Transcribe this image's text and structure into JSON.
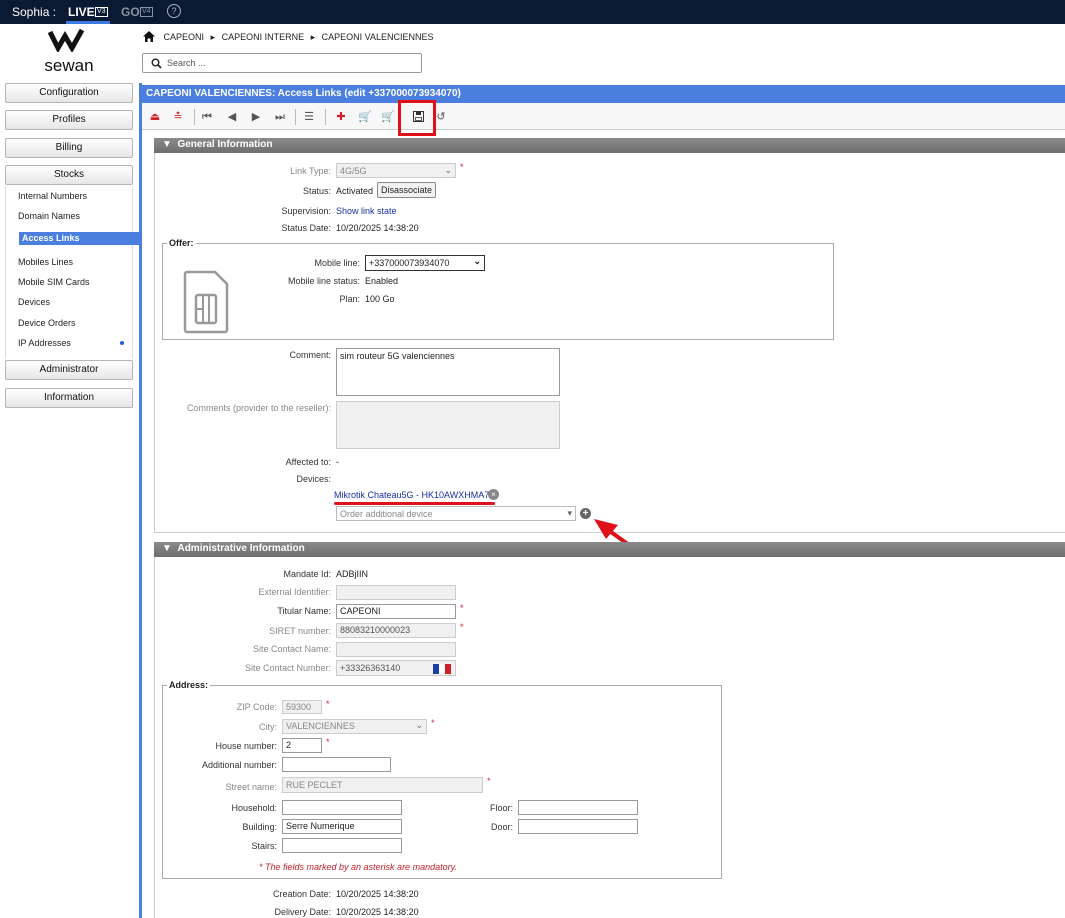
{
  "topbar": {
    "user": "Sophia :",
    "live_label": "LIVE",
    "live_badge": "V3",
    "go_label": "GO",
    "go_badge": "V4",
    "help": "?"
  },
  "logo": {
    "text": "sewan"
  },
  "breadcrumb": [
    "CAPEONI",
    "CAPEONI INTERNE",
    "CAPEONI VALENCIENNES"
  ],
  "search": {
    "placeholder": "Search ..."
  },
  "sidebar": {
    "buttons": {
      "configuration": "Configuration",
      "profiles": "Profiles",
      "billing": "Billing",
      "stocks": "Stocks",
      "administrator": "Administrator",
      "information": "Information"
    },
    "stocks_items": {
      "internal_numbers": "Internal Numbers",
      "domain_names": "Domain Names",
      "access_links": "Access Links",
      "mobiles_lines": "Mobiles Lines",
      "mobile_sim_cards": "Mobile SIM Cards",
      "devices": "Devices",
      "device_orders": "Device Orders",
      "ip_addresses": "IP Addresses"
    }
  },
  "page": {
    "title": "CAPEONI VALENCIENNES: Access Links (edit +337000073934070)"
  },
  "general": {
    "header": "General Information",
    "link_type_label": "Link Type:",
    "link_type_value": "4G/5G",
    "status_label": "Status:",
    "status_value": "Activated",
    "disassociate": "Disassociate",
    "supervision_label": "Supervision:",
    "supervision_link": "Show link state",
    "status_date_label": "Status Date:",
    "status_date_value": "10/20/2025 14:38:20",
    "offer_legend": "Offer:",
    "mobile_line_label": "Mobile line:",
    "mobile_line_value": "+337000073934070",
    "mobile_line_status_label": "Mobile line status:",
    "mobile_line_status_value": "Enabled",
    "plan_label": "Plan:",
    "plan_value": "100 Go",
    "comment_label": "Comment:",
    "comment_value": "sim routeur 5G valenciennes",
    "comments_provider_label": "Comments (provider to the reseller):",
    "affected_label": "Affected to:",
    "affected_value": "-",
    "devices_label": "Devices:",
    "device_value": "Mikrotik Chateau5G - HK10AWXHMA7",
    "order_device_placeholder": "Order additional device"
  },
  "admin": {
    "header": "Administrative Information",
    "mandate_label": "Mandate Id:",
    "mandate_value": "ADBjIIN",
    "external_label": "External Identifier:",
    "titular_label": "Titular Name:",
    "titular_value": "CAPEONI",
    "siret_label": "SIRET number:",
    "siret_value": "88083210000023",
    "site_contact_name_label": "Site Contact Name:",
    "site_contact_number_label": "Site Contact Number:",
    "site_contact_number_value": "+33326363140",
    "address_legend": "Address:",
    "zip_label": "ZIP Code:",
    "zip_value": "59300",
    "city_label": "City:",
    "city_value": "VALENCIENNES",
    "house_label": "House number:",
    "house_value": "2",
    "additional_label": "Additional number:",
    "street_label": "Street name:",
    "street_value": "RUE PECLET",
    "household_label": "Household:",
    "floor_label": "Floor:",
    "building_label": "Building:",
    "building_value": "Serre Numerique",
    "door_label": "Door:",
    "stairs_label": "Stairs:",
    "mandatory_note": "* The fields marked by an asterisk are mandatory.",
    "creation_label": "Creation Date:",
    "creation_value": "10/20/2025 14:38:20",
    "delivery_label": "Delivery Date:",
    "delivery_value": "10/20/2025 14:38:20"
  },
  "colors": {
    "accent": "#4a7fe0",
    "topbar": "#0b1a33",
    "annotation": "#e0101a"
  }
}
